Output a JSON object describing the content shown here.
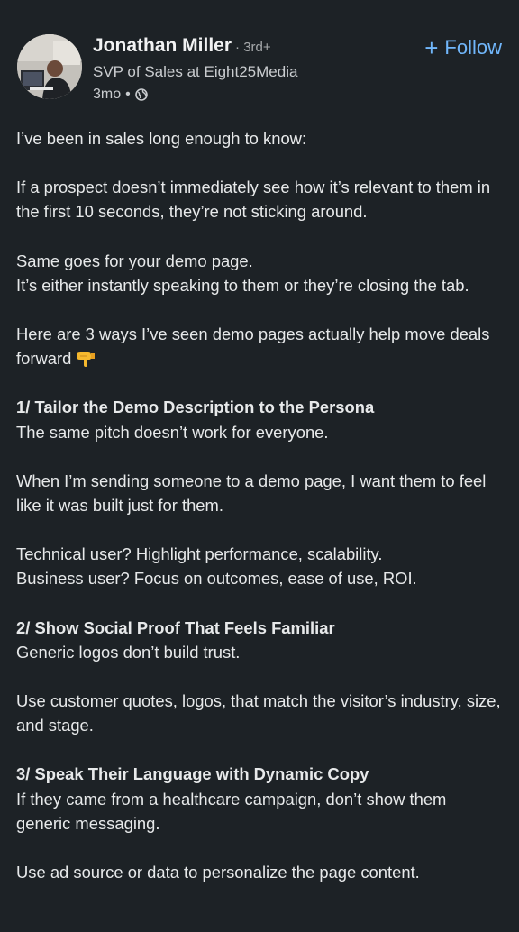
{
  "author": {
    "name": "Jonathan Miller",
    "degree": "· 3rd+",
    "headline": "SVP of Sales at Eight25Media",
    "time": "3mo",
    "dot": "•",
    "visibility_icon": "globe-icon",
    "avatar_icon": "profile-photo"
  },
  "follow": {
    "plus": "+",
    "label": "Follow"
  },
  "post": {
    "p1": "I’ve been in sales long enough to know:",
    "p2": "If a prospect doesn’t immediately see how it’s relevant to them in the first 10 seconds, they’re not sticking around.",
    "p3a": "Same goes for your demo page.",
    "p3b": "It’s either instantly speaking to them or they’re closing the tab.",
    "p4": "Here are 3 ways I’ve seen demo pages actually help move deals forward",
    "p4_emoji": "backhand-index-pointing-down-icon",
    "h1": "1/ Tailor the Demo Description to the Persona",
    "p5": "The same pitch doesn’t work for everyone.",
    "p6": "When I’m sending someone to a demo page, I want them to feel like it was built just for them.",
    "p7a": "Technical user? Highlight performance, scalability.",
    "p7b": "Business user? Focus on outcomes, ease of use, ROI.",
    "h2": "2/ Show Social Proof That Feels Familiar",
    "p8": "Generic logos don’t build trust.",
    "p9": "Use customer quotes, logos, that match the visitor’s industry, size, and stage.",
    "h3": "3/ Speak Their Language with Dynamic Copy",
    "p10": "If they came from a healthcare campaign, don’t show them generic messaging.",
    "p11": "Use ad source or data to personalize the page content."
  },
  "colors": {
    "background": "#1d2226",
    "text": "#e7e9ea",
    "link": "#71b7fb",
    "muted": "#a8abad"
  }
}
